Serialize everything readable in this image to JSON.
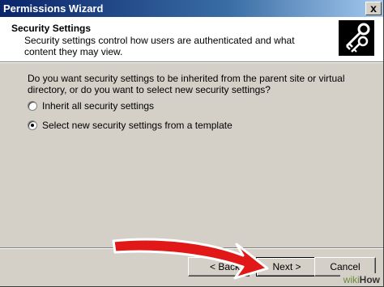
{
  "window": {
    "title": "Permissions Wizard",
    "close_glyph": "x"
  },
  "header": {
    "title": "Security Settings",
    "description": "Security settings control how users are authenticated and what content they may view.",
    "icon": "keys-icon"
  },
  "body": {
    "question": "Do you want security settings to be inherited from the parent site or virtual directory, or do you want to select new security settings?",
    "options": [
      {
        "label": "Inherit all security settings",
        "checked": false
      },
      {
        "label": "Select new security settings from a template",
        "checked": true
      }
    ]
  },
  "buttons": {
    "back": "< Back",
    "next": "Next >",
    "cancel": "Cancel"
  },
  "overlay": {
    "arrow_color": "#e01818",
    "arrow_points_to": "next-button"
  },
  "watermark": {
    "part1": "wiki",
    "part2": "How"
  }
}
